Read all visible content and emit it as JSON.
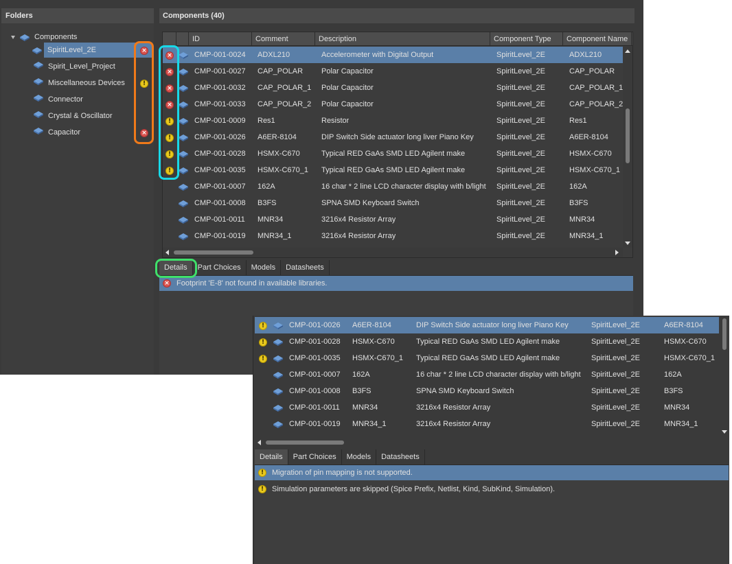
{
  "folders": {
    "title": "Folders",
    "root": "Components",
    "items": [
      {
        "label": "SpiritLevel_2E",
        "status": "error",
        "selected": true
      },
      {
        "label": "Spirit_Level_Project",
        "status": ""
      },
      {
        "label": "Miscellaneous Devices",
        "status": "warning"
      },
      {
        "label": "Connector",
        "status": ""
      },
      {
        "label": "Crystal & Oscillator",
        "status": ""
      },
      {
        "label": "Capacitor",
        "status": "error"
      }
    ]
  },
  "components": {
    "title": "Components (40)",
    "columns": [
      "ID",
      "Comment",
      "Description",
      "Component Type",
      "Component Name"
    ],
    "rows": [
      {
        "status": "error",
        "id": "CMP-001-0024",
        "comment": "ADXL210",
        "description": "Accelerometer with Digital Output",
        "type": "SpiritLevel_2E",
        "name": "ADXL210",
        "selected": true
      },
      {
        "status": "error",
        "id": "CMP-001-0027",
        "comment": "CAP_POLAR",
        "description": "Polar Capacitor",
        "type": "SpiritLevel_2E",
        "name": "CAP_POLAR"
      },
      {
        "status": "error",
        "id": "CMP-001-0032",
        "comment": "CAP_POLAR_1",
        "description": "Polar Capacitor",
        "type": "SpiritLevel_2E",
        "name": "CAP_POLAR_1"
      },
      {
        "status": "error",
        "id": "CMP-001-0033",
        "comment": "CAP_POLAR_2",
        "description": "Polar Capacitor",
        "type": "SpiritLevel_2E",
        "name": "CAP_POLAR_2"
      },
      {
        "status": "warning",
        "id": "CMP-001-0009",
        "comment": "Res1",
        "description": "Resistor",
        "type": "SpiritLevel_2E",
        "name": "Res1"
      },
      {
        "status": "warning",
        "id": "CMP-001-0026",
        "comment": "A6ER-8104",
        "description": "DIP Switch Side actuator long liver Piano Key",
        "type": "SpiritLevel_2E",
        "name": "A6ER-8104"
      },
      {
        "status": "warning",
        "id": "CMP-001-0028",
        "comment": "HSMX-C670",
        "description": "Typical RED GaAs SMD LED Agilent make",
        "type": "SpiritLevel_2E",
        "name": "HSMX-C670"
      },
      {
        "status": "warning",
        "id": "CMP-001-0035",
        "comment": "HSMX-C670_1",
        "description": "Typical RED GaAs SMD LED Agilent make",
        "type": "SpiritLevel_2E",
        "name": "HSMX-C670_1"
      },
      {
        "status": "",
        "id": "CMP-001-0007",
        "comment": "162A",
        "description": "16 char * 2 line LCD character display with b/light",
        "type": "SpiritLevel_2E",
        "name": "162A"
      },
      {
        "status": "",
        "id": "CMP-001-0008",
        "comment": "B3FS",
        "description": "SPNA SMD Keyboard Switch",
        "type": "SpiritLevel_2E",
        "name": "B3FS"
      },
      {
        "status": "",
        "id": "CMP-001-0011",
        "comment": "MNR34",
        "description": "3216x4 Resistor Array",
        "type": "SpiritLevel_2E",
        "name": "MNR34"
      },
      {
        "status": "",
        "id": "CMP-001-0019",
        "comment": "MNR34_1",
        "description": "3216x4 Resistor Array",
        "type": "SpiritLevel_2E",
        "name": "MNR34_1"
      }
    ]
  },
  "tabs": [
    "Details",
    "Part Choices",
    "Models",
    "Datasheets"
  ],
  "details_back": [
    {
      "status": "error",
      "text": "Footprint 'E-8' not found in available libraries."
    }
  ],
  "front": {
    "rows": [
      {
        "status": "warning",
        "id": "CMP-001-0026",
        "comment": "A6ER-8104",
        "description": "DIP Switch Side actuator long liver Piano Key",
        "type": "SpiritLevel_2E",
        "name": "A6ER-8104",
        "selected": true
      },
      {
        "status": "warning",
        "id": "CMP-001-0028",
        "comment": "HSMX-C670",
        "description": "Typical RED GaAs SMD LED Agilent make",
        "type": "SpiritLevel_2E",
        "name": "HSMX-C670"
      },
      {
        "status": "warning",
        "id": "CMP-001-0035",
        "comment": "HSMX-C670_1",
        "description": "Typical RED GaAs SMD LED Agilent make",
        "type": "SpiritLevel_2E",
        "name": "HSMX-C670_1"
      },
      {
        "status": "",
        "id": "CMP-001-0007",
        "comment": "162A",
        "description": "16 char * 2 line LCD character display with b/light",
        "type": "SpiritLevel_2E",
        "name": "162A"
      },
      {
        "status": "",
        "id": "CMP-001-0008",
        "comment": "B3FS",
        "description": "SPNA SMD Keyboard Switch",
        "type": "SpiritLevel_2E",
        "name": "B3FS"
      },
      {
        "status": "",
        "id": "CMP-001-0011",
        "comment": "MNR34",
        "description": "3216x4 Resistor Array",
        "type": "SpiritLevel_2E",
        "name": "MNR34"
      },
      {
        "status": "",
        "id": "CMP-001-0019",
        "comment": "MNR34_1",
        "description": "3216x4 Resistor Array",
        "type": "SpiritLevel_2E",
        "name": "MNR34_1"
      }
    ],
    "details": [
      {
        "status": "warning",
        "text": "Migration of pin mapping is not supported."
      },
      {
        "status": "warning",
        "text": "Simulation parameters are skipped (Spice Prefix, Netlist, Kind, SubKind, Simulation)."
      }
    ]
  },
  "icons": {
    "component": "component-icon",
    "error": "error-icon",
    "warning": "warning-icon"
  },
  "colors": {
    "selection": "#5a7fa8",
    "error": "#d9534f",
    "warning": "#e8c81e",
    "highlight_orange": "#f07a1a",
    "highlight_cyan": "#17d9e8",
    "highlight_green": "#3fe06a"
  }
}
